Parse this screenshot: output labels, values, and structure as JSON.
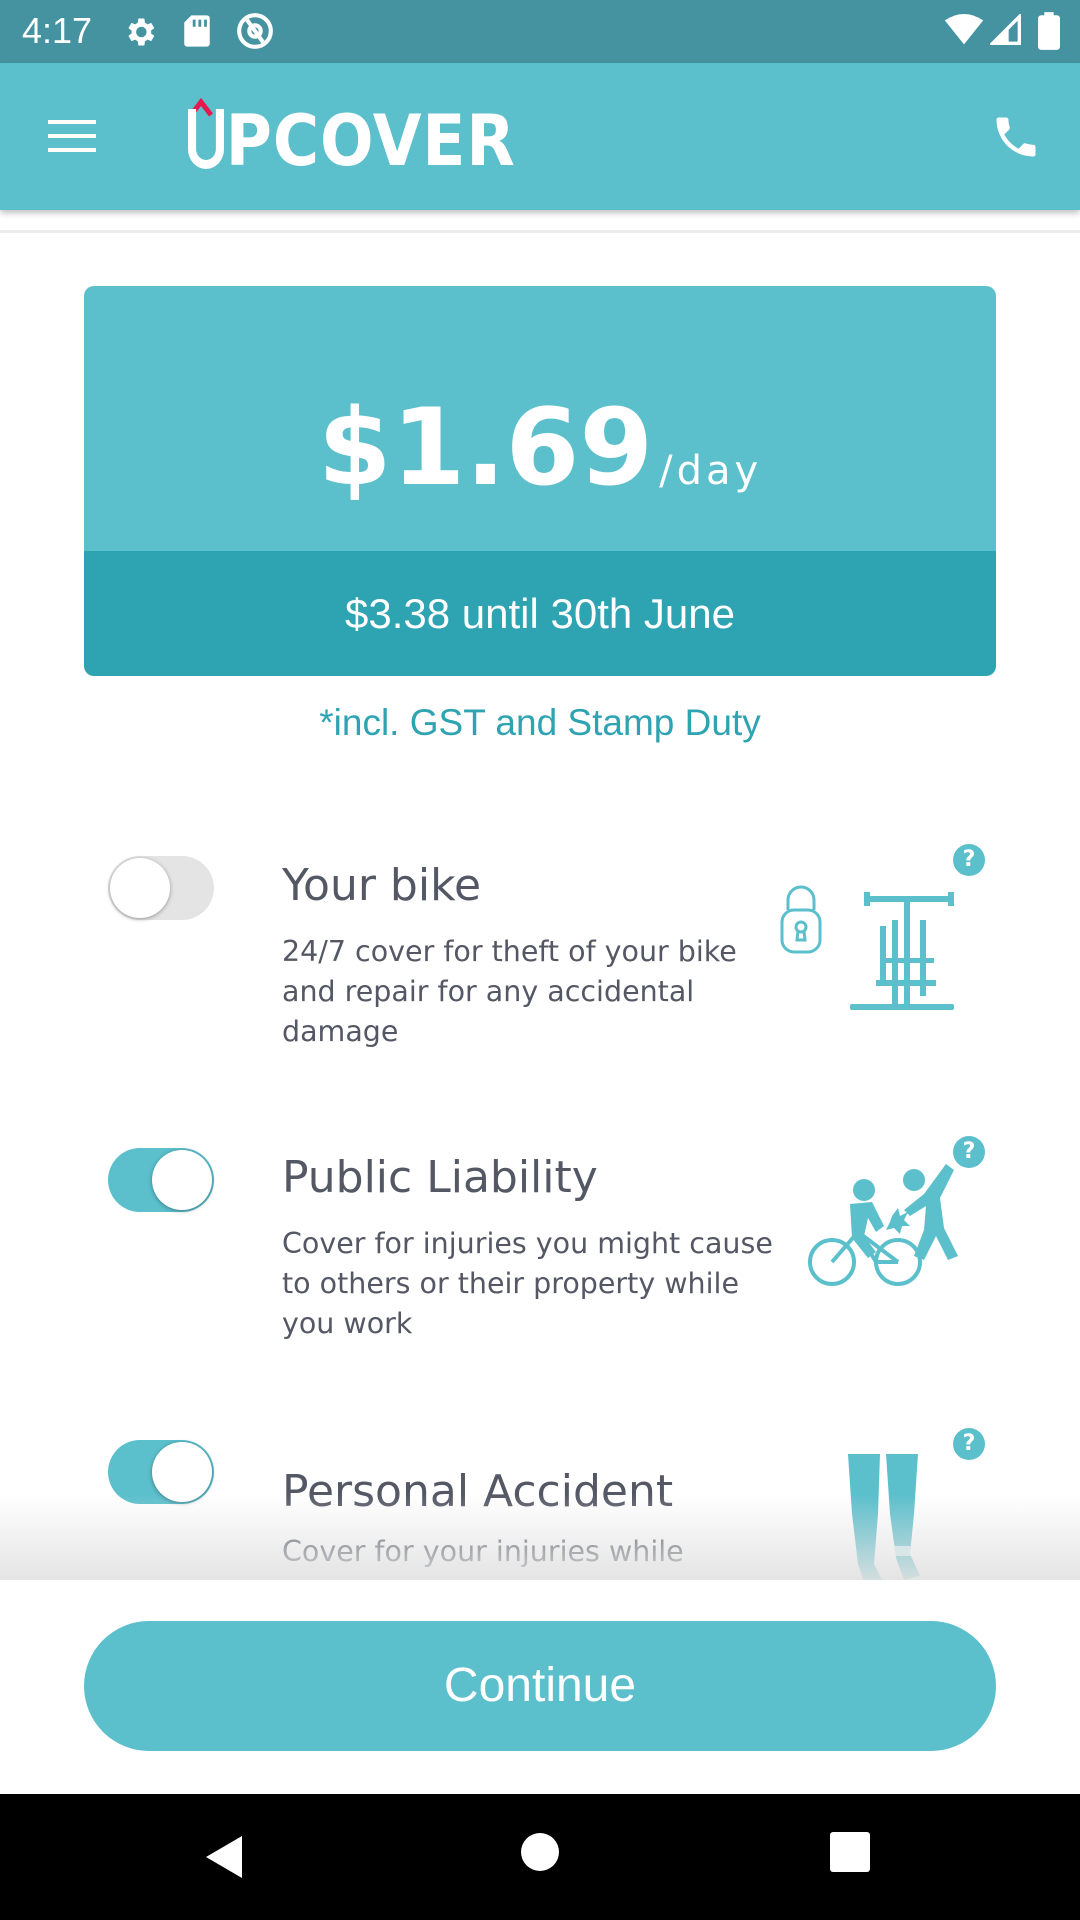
{
  "status_bar": {
    "time": "4:17",
    "icons": [
      "settings-gear-icon",
      "sd-card-icon",
      "at-sign-icon",
      "wifi-icon",
      "signal-icon",
      "battery-icon"
    ]
  },
  "app_bar": {
    "logo_text": "UPCOVER",
    "logo_display": "PCOVER",
    "icons": [
      "menu-icon",
      "phone-icon"
    ]
  },
  "price": {
    "amount": "$1.69",
    "unit": "/day",
    "until": "$3.38 until 30th June",
    "note": "*incl. GST and Stamp Duty"
  },
  "covers": [
    {
      "title": "Your bike",
      "description": "24/7 cover for theft of your bike and repair for any accidental damage",
      "enabled": false,
      "illustration": "bike-lock-icon"
    },
    {
      "title": "Public Liability",
      "description": "Cover for injuries you might cause to others or their property while you work",
      "enabled": true,
      "illustration": "cyclist-collision-icon"
    },
    {
      "title": "Personal Accident",
      "description": "Cover for your injuries while",
      "enabled": true,
      "illustration": "injured-legs-icon"
    }
  ],
  "help_label": "?",
  "continue_label": "Continue",
  "colors": {
    "status_bar": "#4593a0",
    "primary": "#5bbfcc",
    "primary_dark": "#2ea3b2",
    "text": "#545865"
  }
}
